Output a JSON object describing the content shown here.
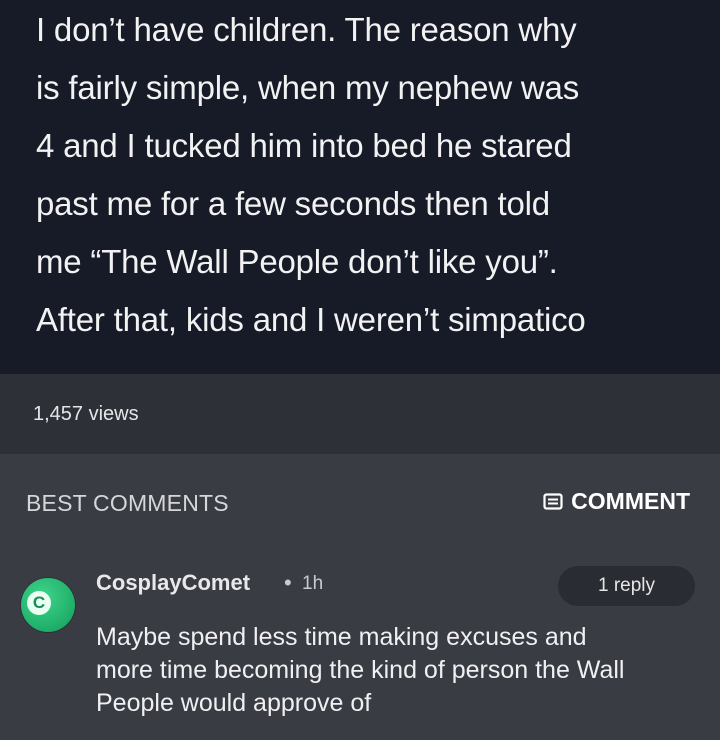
{
  "post": {
    "lines": [
      "I don’t have children. The reason why",
      "is fairly simple, when my nephew was",
      "4 and I tucked him into bed he stared",
      "past me for a few seconds then told",
      "me “The Wall People don’t like you”.",
      "After that, kids and I weren’t simpatico"
    ],
    "views": "1,457 views"
  },
  "comments_section": {
    "header": "BEST COMMENTS",
    "comment_button": "COMMENT",
    "comment_icon": "comment-icon"
  },
  "comment": {
    "avatar_letter": "C",
    "username": "CosplayComet",
    "separator": "•",
    "time": "1h",
    "reply_count": "1 reply",
    "lines": [
      "Maybe spend less time making excuses and",
      "more time becoming the kind of person the Wall",
      "People would approve of"
    ]
  },
  "colors": {
    "post_background": "#161b27",
    "views_background": "#2e3038",
    "comments_background": "#3a3c44",
    "avatar_green": "#1fae68"
  }
}
